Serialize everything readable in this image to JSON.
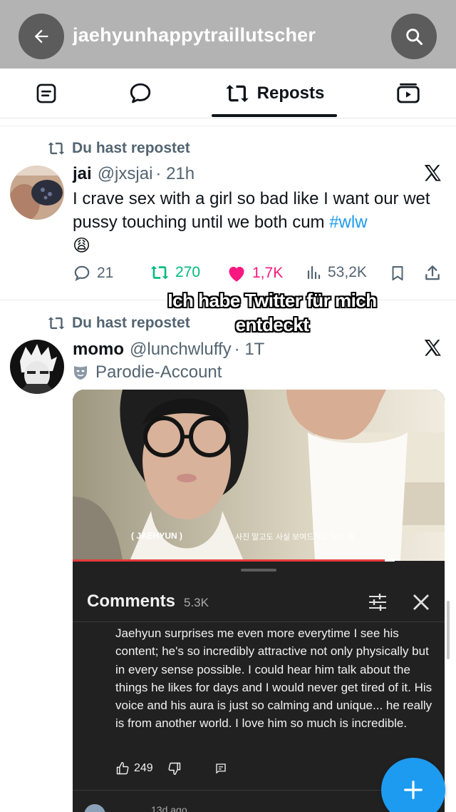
{
  "header": {
    "title": "jaehyunhappytraillutscher"
  },
  "tabs": {
    "active_label": "Reposts"
  },
  "posts": [
    {
      "repost_label": "Du hast repostet",
      "name": "jai",
      "handle": "@jxsjai",
      "time": "· 21h",
      "text": "I crave sex with a girl so bad like I want our wet pussy touching until we both cum",
      "hashtag": "#wlw",
      "emoji": "😩",
      "replies": "21",
      "reposts": "270",
      "likes": "1,7K",
      "views": "53,2K"
    },
    {
      "repost_label": "Du hast repostet",
      "name": "momo",
      "handle": "@lunchwluffy",
      "time": "· 1T",
      "badge": "Parodie-Account",
      "media": {
        "caption_name": "( JAEHYUN )",
        "caption_sub": "사진 말고도 사실 보여드리고 싶은 게",
        "comments_title": "Comments",
        "comments_count": "5.3K",
        "comment_text": "Jaehyun surprises me even more everytime I see his content; he's so incredibly attractive not only physically but in every sense possible. I could hear him talk about the things he likes for days and I would never get tired of it. His voice and his aura is just so calming and unique... he really is from another world. I love him so much is incredible.",
        "comment_likes": "249",
        "next_comment_meta": "13d ago"
      }
    }
  ],
  "overlay": {
    "line1": "Ich habe Twitter für mich",
    "line2": "entdeckt"
  },
  "colors": {
    "accent": "#1d9bf0",
    "repost_green": "#00ba7c",
    "like_pink": "#f91880",
    "header_bg": "#b3b3b3"
  },
  "icons": [
    "back-arrow-icon",
    "search-icon",
    "posts-tab-icon",
    "replies-tab-icon",
    "repost-icon",
    "media-tab-icon",
    "x-logo-icon",
    "reply-icon",
    "heart-icon",
    "views-icon",
    "bookmark-icon",
    "share-icon",
    "parody-mask-icon",
    "plus-icon"
  ]
}
